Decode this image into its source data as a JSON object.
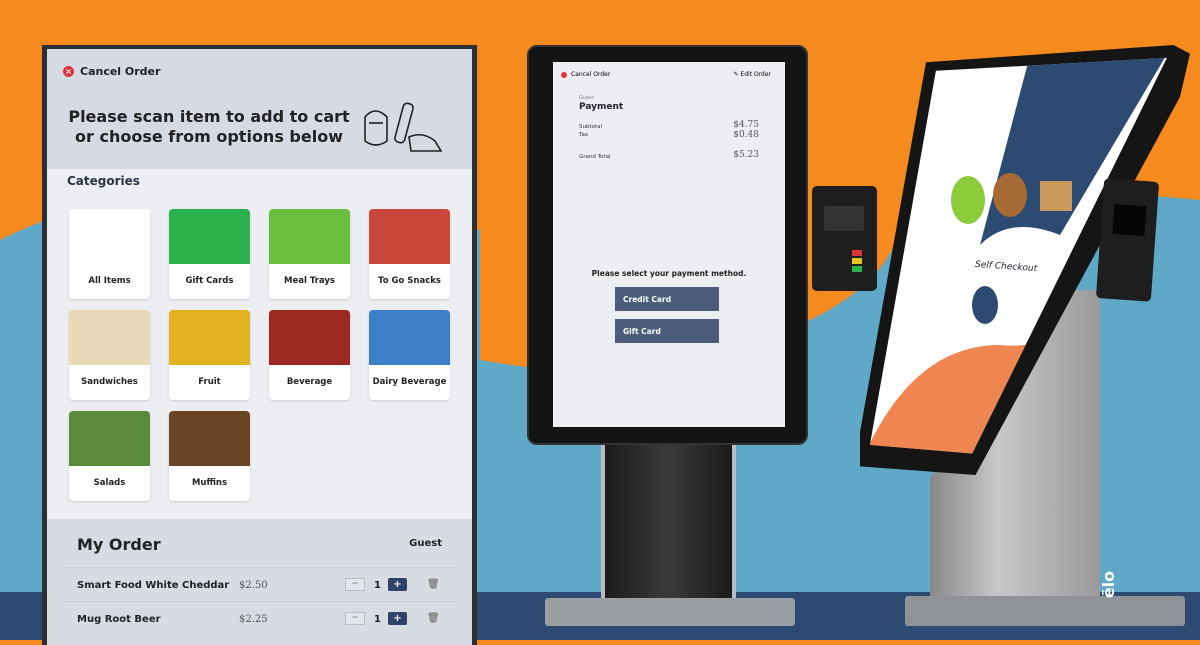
{
  "colors": {
    "orange": "#f58a1f",
    "blue": "#5fa8c8",
    "navy": "#2d4266",
    "danger": "#e0323c"
  },
  "left_screen": {
    "cancel_label": "Cancel Order",
    "prompt": "Please scan item to add to cart or choose from options below",
    "categories_heading": "Categories",
    "categories": [
      {
        "label": "All Items",
        "color": "#ffffff"
      },
      {
        "label": "Gift Cards",
        "color": "#2bb24c"
      },
      {
        "label": "Meal Trays",
        "color": "#6abf3f"
      },
      {
        "label": "To Go Snacks",
        "color": "#c9463a"
      },
      {
        "label": "Sandwiches",
        "color": "#e8d9b8"
      },
      {
        "label": "Fruit",
        "color": "#e2b21f"
      },
      {
        "label": "Beverage",
        "color": "#9b2a23"
      },
      {
        "label": "Dairy Beverage",
        "color": "#3a7fc8"
      },
      {
        "label": "Salads",
        "color": "#5a8a3a"
      },
      {
        "label": "Muffins",
        "color": "#6b4426"
      }
    ],
    "order": {
      "title": "My Order",
      "user": "Guest",
      "items": [
        {
          "name": "Smart Food White Cheddar",
          "price": "$2.50",
          "qty": "1"
        },
        {
          "name": "Mug Root Beer",
          "price": "$2.25",
          "qty": "1"
        }
      ],
      "minus": "−",
      "plus": "+"
    }
  },
  "middle_screen": {
    "cancel_label": "Cancel Order",
    "edit_label": "Edit Order",
    "user": "Guest",
    "title": "Payment",
    "subtotal_label": "Subtotal",
    "subtotal": "$4.75",
    "tax_label": "Tax",
    "tax": "$0.48",
    "grand_total_label": "Grand Total",
    "grand_total": "$5.23",
    "select_prompt": "Please select your payment method.",
    "buttons": [
      "Credit Card",
      "Gift Card"
    ]
  },
  "right_screen": {
    "title": "Self Checkout"
  },
  "brand_logo": "elo"
}
